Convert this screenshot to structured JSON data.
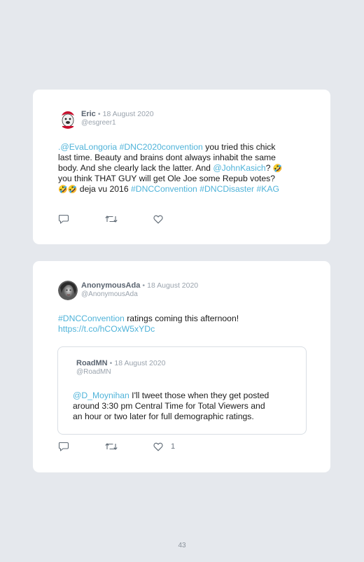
{
  "tweets": [
    {
      "author": "Eric",
      "separator": "•",
      "date": "18 August 2020",
      "handle": "@esgreer1",
      "lines": [
        [
          {
            "text": ".",
            "type": "link"
          },
          {
            "text": "@EvaLongoria",
            "type": "link"
          },
          {
            "text": " ",
            "type": "text"
          },
          {
            "text": "#DNC2020convention",
            "type": "link"
          },
          {
            "text": " you tried this chick",
            "type": "text"
          }
        ],
        [
          {
            "text": "last time. Beauty and brains dont always inhabit the same",
            "type": "text"
          }
        ],
        [
          {
            "text": "body. And she clearly lack the latter. And ",
            "type": "text"
          },
          {
            "text": "@JohnKasich",
            "type": "link"
          },
          {
            "text": "? ",
            "type": "text"
          },
          {
            "text": "🤣",
            "type": "emoji"
          }
        ],
        [
          {
            "text": "you think THAT GUY will get Ole Joe some Repub votes?",
            "type": "text"
          }
        ],
        [
          {
            "text": "🤣🤣",
            "type": "emoji"
          },
          {
            "text": " deja vu 2016 ",
            "type": "text"
          },
          {
            "text": "#DNCConvention",
            "type": "link"
          },
          {
            "text": " ",
            "type": "text"
          },
          {
            "text": "#DNCDisaster",
            "type": "link"
          },
          {
            "text": " ",
            "type": "text"
          },
          {
            "text": "#KAG",
            "type": "link"
          }
        ]
      ],
      "like_count": ""
    },
    {
      "author": "AnonymousAda",
      "separator": "•",
      "date": "18 August 2020",
      "handle": "@AnonymousAda",
      "lines": [
        [
          {
            "text": "#DNCConvention",
            "type": "link"
          },
          {
            "text": " ratings coming this afternoon!",
            "type": "text"
          }
        ],
        [
          {
            "text": "https://t.co/hCOxW5xYDc",
            "type": "link"
          }
        ]
      ],
      "quoted": {
        "author": "RoadMN",
        "separator": "•",
        "date": "18 August 2020",
        "handle": "@RoadMN",
        "lines": [
          [
            {
              "text": "@D_Moynihan",
              "type": "link"
            },
            {
              "text": " I'll tweet those when they get posted",
              "type": "text"
            }
          ],
          [
            {
              "text": "around 3:30 pm Central Time for Total Viewers and",
              "type": "text"
            }
          ],
          [
            {
              "text": "an hour or two later for full demographic ratings.",
              "type": "text"
            }
          ]
        ]
      },
      "like_count": "1"
    }
  ],
  "icons": {
    "reply": "reply-icon",
    "retweet": "retweet-icon",
    "like": "heart-icon"
  },
  "colors": {
    "page_background": "#e5e8ed",
    "card_background": "#ffffff",
    "link": "#4fb3d9",
    "name": "#5a6470",
    "muted": "#9aa3ad"
  },
  "page_number": "43"
}
